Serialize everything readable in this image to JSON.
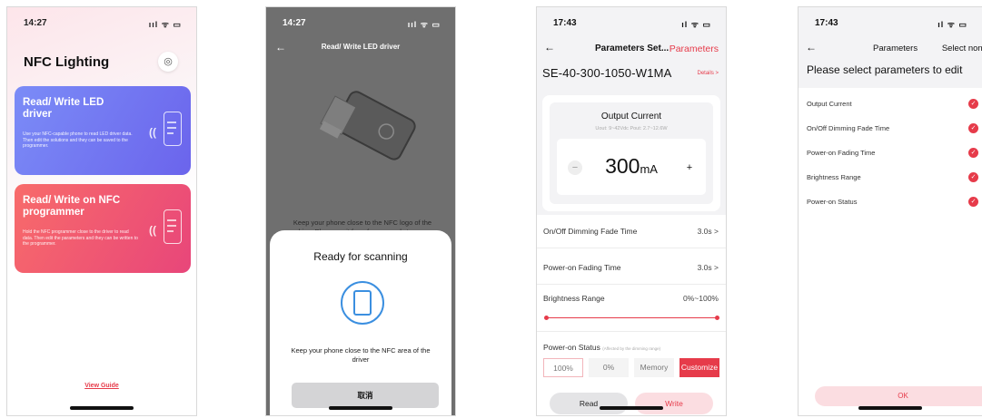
{
  "status_bar": {
    "screen1_time": "14:27",
    "screen2_time": "14:27",
    "screen3_time": "17:43",
    "screen4_time": "17:43",
    "icons_a": "ııl ᯤ ▭",
    "icons_b": "ıl ᯤ ▭"
  },
  "home": {
    "title": "NFC Lighting",
    "card_led": {
      "title": "Read/ Write LED driver",
      "description": "Use your NFC-capable phone to read LED driver data. Then edit the solutions and they can be saved to the programmer."
    },
    "card_programmer": {
      "title": "Read/ Write on NFC programmer",
      "description": "Hold the NFC programmer close to the driver to read data. Then edit the parameters and they can be written to the programmer."
    },
    "view_guide": "View Guide"
  },
  "scan": {
    "header": "Read/ Write LED driver",
    "background_text": "Keep your phone close to the NFC logo of the driver.Please wait for a few seconds to scan successfully. Then it is ready to edit the driver",
    "sheet_title": "Ready for scanning",
    "sheet_desc": "Keep your phone close to the NFC area of the driver",
    "cancel": "取消"
  },
  "params": {
    "header": "Parameters Set...",
    "header_right": "Parameters",
    "model": "SE-40-300-1050-W1MA",
    "details": "Details >",
    "output_current": {
      "title": "Output Current",
      "subtitle": "Uout: 9~42Vdc  Pout: 2.7~12.6W",
      "value": "300",
      "unit": "mA",
      "minus": "−",
      "plus": "+"
    },
    "rows": [
      {
        "label": "On/Off Dimming Fade Time",
        "value": "3.0s >"
      },
      {
        "label": "Power-on Fading Time",
        "value": "3.0s >"
      },
      {
        "label": "Brightness Range",
        "value": "0%~100%"
      }
    ],
    "brightness_range": {
      "min": 0,
      "max": 100
    },
    "power_on_status": {
      "label": "Power-on Status",
      "hint": "(Affected by the dimming range)",
      "options": [
        "100%",
        "0%",
        "Memory",
        "Customize"
      ],
      "selected": "Customize"
    },
    "read": "Read",
    "write": "Write"
  },
  "select": {
    "header": "Parameters",
    "select_none": "Select none",
    "heading": "Please select parameters to edit",
    "items": [
      "Output Current",
      "On/Off Dimming Fade Time",
      "Power-on Fading Time",
      "Brightness Range",
      "Power-on Status"
    ],
    "ok": "OK"
  },
  "colors": {
    "accent": "#e63b4a",
    "card_blue": "#6b64ec",
    "card_red": "#e8467a",
    "scan_blue": "#3b8fe0"
  }
}
